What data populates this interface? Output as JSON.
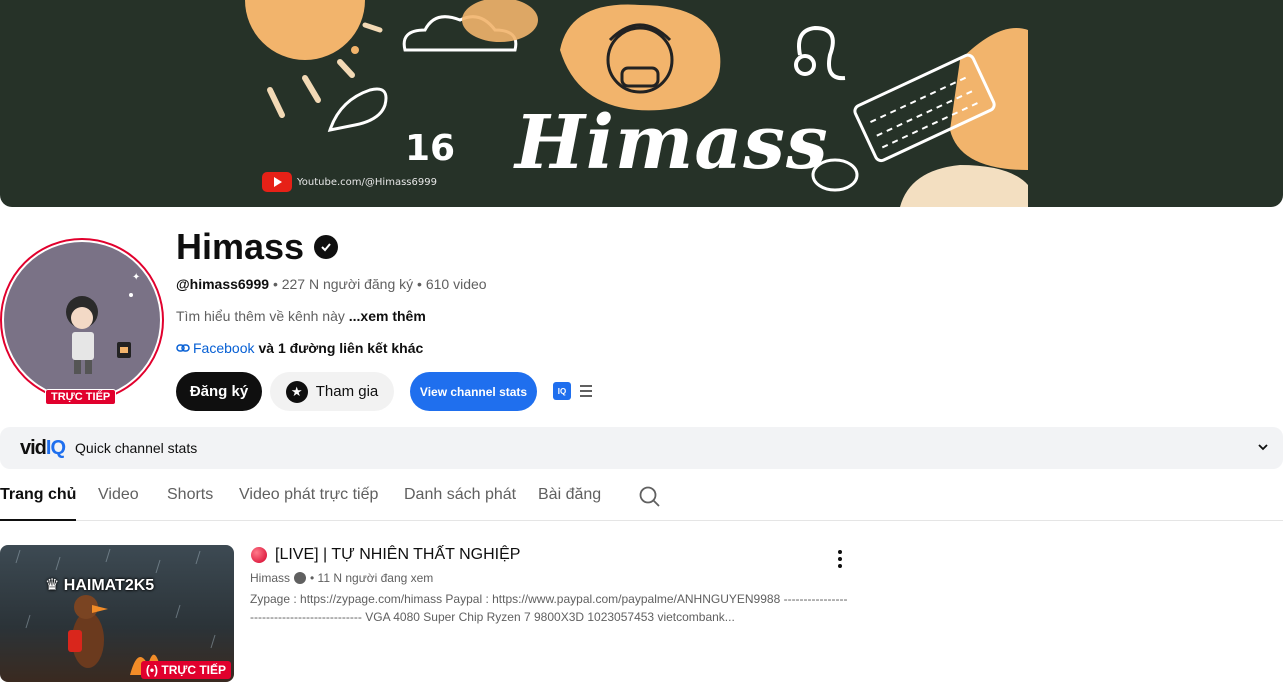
{
  "banner": {
    "title": "Himass",
    "number": "16",
    "youtube_link": "Youtube.com/@Himass6999"
  },
  "channel": {
    "name": "Himass",
    "handle": "@himass6999",
    "subscribers": "227 N người đăng ký",
    "videos": "610 video",
    "about": "Tìm hiểu thêm về kênh này",
    "see_more": "...xem thêm",
    "link_name": "Facebook",
    "more_links": "và 1 đường liên kết khác",
    "live_badge": "TRỰC TIẾP"
  },
  "actions": {
    "subscribe": "Đăng ký",
    "join": "Tham gia",
    "stats": "View channel stats",
    "iq_badge": "IQ"
  },
  "vidiq": {
    "logo_vid": "vid",
    "logo_iq": "IQ",
    "label": "Quick channel stats"
  },
  "tabs": [
    {
      "label": "Trang chủ"
    },
    {
      "label": "Video"
    },
    {
      "label": "Shorts"
    },
    {
      "label": "Video phát trực tiếp"
    },
    {
      "label": "Danh sách phát"
    },
    {
      "label": "Bài đăng"
    }
  ],
  "video": {
    "thumb_title": "HAIMAT2K5",
    "thumb_live": "TRỰC TIẾP",
    "title": "[LIVE] | TỰ NHIÊN THẤT NGHIỆP",
    "channel": "Himass",
    "viewers": "• 11 N người đang xem",
    "description": "Zypage : https://zypage.com/himass Paypal : https://www.paypal.com/paypalme/ANHNGUYEN9988 -------------------------------------------- VGA 4080 Super Chip Ryzen 7 9800X3D 1023057453 vietcombank..."
  },
  "colors": {
    "banner_bg": "#263228",
    "accent_blue": "#1f6fee",
    "live_red": "#e1002d",
    "banner_orange": "#f2b46c"
  }
}
